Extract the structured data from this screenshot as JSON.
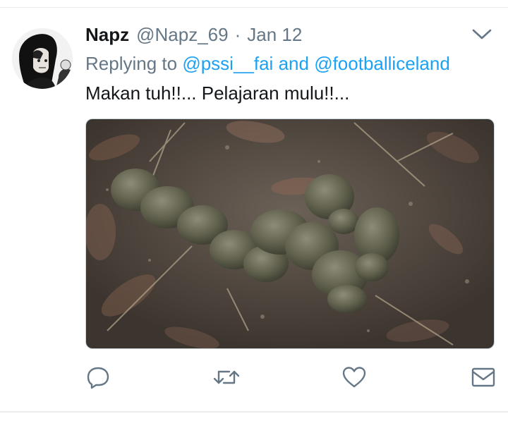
{
  "tweet": {
    "display_name": "Napz",
    "handle": "@Napz_69",
    "separator": "·",
    "date": "Jan 12",
    "replying_prefix": "Replying to",
    "reply_mention_1": "@pssi__fai",
    "reply_conjunction": "and",
    "reply_mention_2": "@footballiceland",
    "text": "Makan tuh!!... Pelajaran mulu!!..."
  },
  "icons": {
    "caret": "chevron-down-icon",
    "reply": "reply-icon",
    "retweet": "retweet-icon",
    "like": "heart-icon",
    "dm": "envelope-icon"
  },
  "colors": {
    "link": "#1da1f2",
    "secondary_text": "#657786",
    "primary_text": "#14171a",
    "icon": "#657786"
  }
}
